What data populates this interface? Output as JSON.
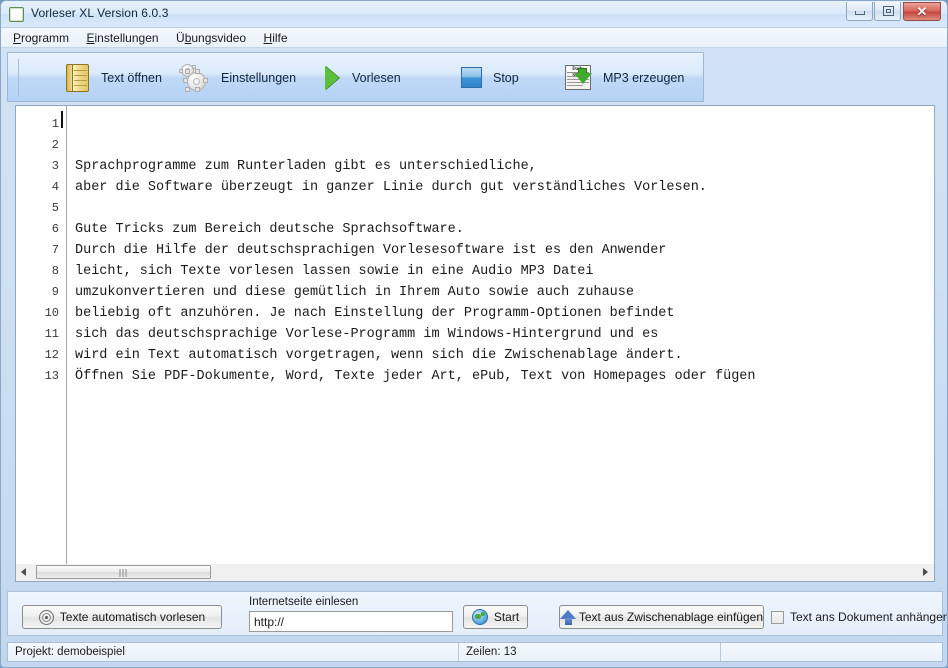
{
  "window": {
    "title": "Vorleser XL Version 6.0.3",
    "app_icon": "app-icon",
    "controls": {
      "minimize": "minimize-button",
      "maximize": "maximize-button",
      "close_glyph": "✕"
    }
  },
  "menu": {
    "items": [
      {
        "acc": "P",
        "rest": "rogramm"
      },
      {
        "acc": "E",
        "rest": "instellungen"
      },
      {
        "pre": "Ü",
        "acc": "b",
        "rest": "ungsvideo"
      },
      {
        "acc": "H",
        "rest": "ilfe"
      }
    ]
  },
  "toolbar": {
    "buttons": [
      {
        "label": "Text öffnen",
        "icon": "book-icon"
      },
      {
        "label": "Einstellungen",
        "icon": "gears-icon"
      },
      {
        "label": "Vorlesen",
        "icon": "play-icon"
      },
      {
        "label": "Stop",
        "icon": "stop-icon"
      },
      {
        "label": "MP3 erzeugen",
        "icon": "newspaper-download-icon"
      }
    ],
    "news_masthead": "Daily News"
  },
  "editor": {
    "line_numbers": [
      "1",
      "2",
      "3",
      "4",
      "5",
      "6",
      "7",
      "8",
      "9",
      "10",
      "11",
      "12",
      "13"
    ],
    "lines": [
      "",
      "",
      "Sprachprogramme zum Runterladen gibt es unterschiedliche,",
      "aber die Software überzeugt in ganzer Linie durch gut verständliches Vorlesen.",
      "",
      "Gute Tricks zum Bereich deutsche Sprachsoftware.",
      "Durch die Hilfe der deutschsprachigen Vorlesesoftware ist es den Anwender",
      "leicht, sich Texte vorlesen lassen sowie in eine Audio MP3 Datei",
      "umzukonvertieren und diese gemütlich in Ihrem Auto sowie auch zuhause",
      "beliebig oft anzuhören. Je nach Einstellung der Programm-Optionen befindet",
      "sich das deutschsprachige Vorlese-Programm im Windows-Hintergrund und es",
      "wird ein Text automatisch vorgetragen, wenn sich die Zwischenablage ändert.",
      "Öffnen Sie PDF-Dokumente, Word, Texte jeder Art, ePub, Text von Homepages oder fügen"
    ]
  },
  "bottom": {
    "auto_read_button": "Texte automatisch vorlesen",
    "url_label": "Internetseite einlesen",
    "url_value": "http://",
    "start_button": "Start",
    "clipboard_button": "Text aus Zwischenablage einfügen",
    "append_checkbox_label": "Text ans Dokument anhängen",
    "append_checked": false
  },
  "status": {
    "project": "Projekt: demobeispiel",
    "lines": "Zeilen: 13",
    "third": ""
  },
  "colors": {
    "frame": "#c2d7ef",
    "toolbar_top": "#e8f1fc",
    "toolbar_bottom": "#b5d2f6",
    "close_button": "#c4483c",
    "play_green": "#5cc13a",
    "stop_blue": "#2f86cd",
    "arrow_green": "#3faa2e",
    "arrow_blue": "#4f78c8"
  }
}
